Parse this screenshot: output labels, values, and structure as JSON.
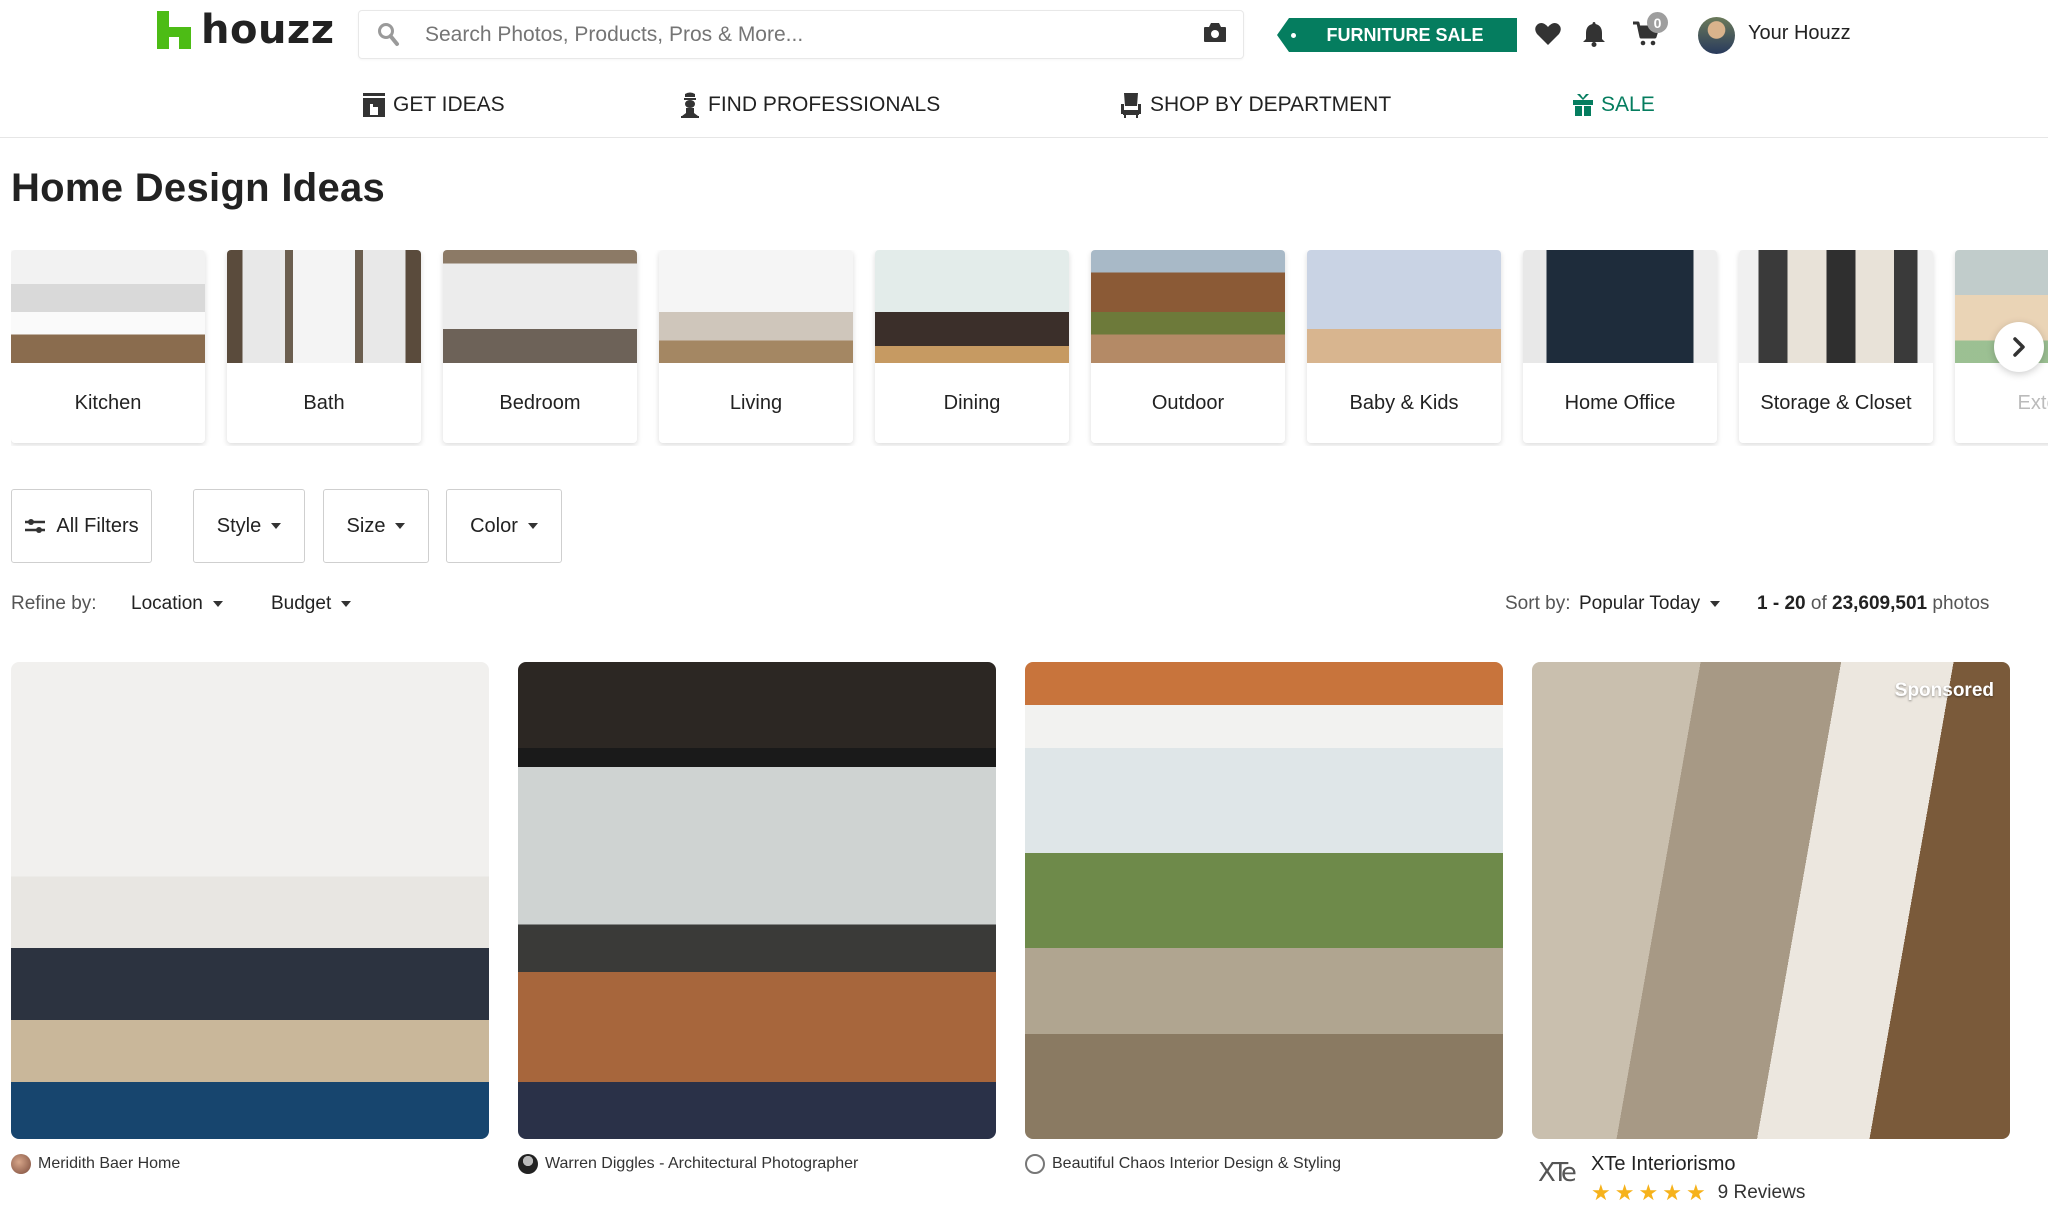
{
  "header": {
    "logo_text": "houzz",
    "search_placeholder": "Search Photos, Products, Pros & More...",
    "promo_label": "FURNITURE SALE",
    "cart_count": "0",
    "account_label": "Your Houzz",
    "icons": [
      "search-icon",
      "camera-icon",
      "heart-icon",
      "bell-icon",
      "cart-icon"
    ]
  },
  "nav": [
    {
      "label": "GET IDEAS",
      "icon": "ideas-icon"
    },
    {
      "label": "FIND PROFESSIONALS",
      "icon": "professional-icon"
    },
    {
      "label": "SHOP BY DEPARTMENT",
      "icon": "chair-icon"
    },
    {
      "label": "SALE",
      "icon": "gift-icon"
    }
  ],
  "page_title": "Home Design Ideas",
  "categories": [
    {
      "label": "Kitchen"
    },
    {
      "label": "Bath"
    },
    {
      "label": "Bedroom"
    },
    {
      "label": "Living"
    },
    {
      "label": "Dining"
    },
    {
      "label": "Outdoor"
    },
    {
      "label": "Baby & Kids"
    },
    {
      "label": "Home Office"
    },
    {
      "label": "Storage & Closet"
    },
    {
      "label": "Exterior"
    }
  ],
  "filters": {
    "all_filters": "All Filters",
    "style": "Style",
    "size": "Size",
    "color": "Color"
  },
  "refine": {
    "label": "Refine by:",
    "location": "Location",
    "budget": "Budget"
  },
  "sort": {
    "label": "Sort by:",
    "value": "Popular Today"
  },
  "results": {
    "range": "1 - 20",
    "of": "of",
    "total": "23,609,501",
    "unit": "photos"
  },
  "photos": [
    {
      "author": "Meridith Baer Home"
    },
    {
      "author": "Warren Diggles - Architectural Photographer"
    },
    {
      "author": "Beautiful Chaos Interior Design & Styling"
    },
    {
      "author": "XTe Interiorismo",
      "badge": "Sponsored",
      "logo_text": "XTe",
      "rating": 5,
      "reviews": "9 Reviews"
    }
  ],
  "colors": {
    "brand_green": "#4dbc15",
    "sale_green": "#057d5f",
    "star": "#f6b21b"
  }
}
